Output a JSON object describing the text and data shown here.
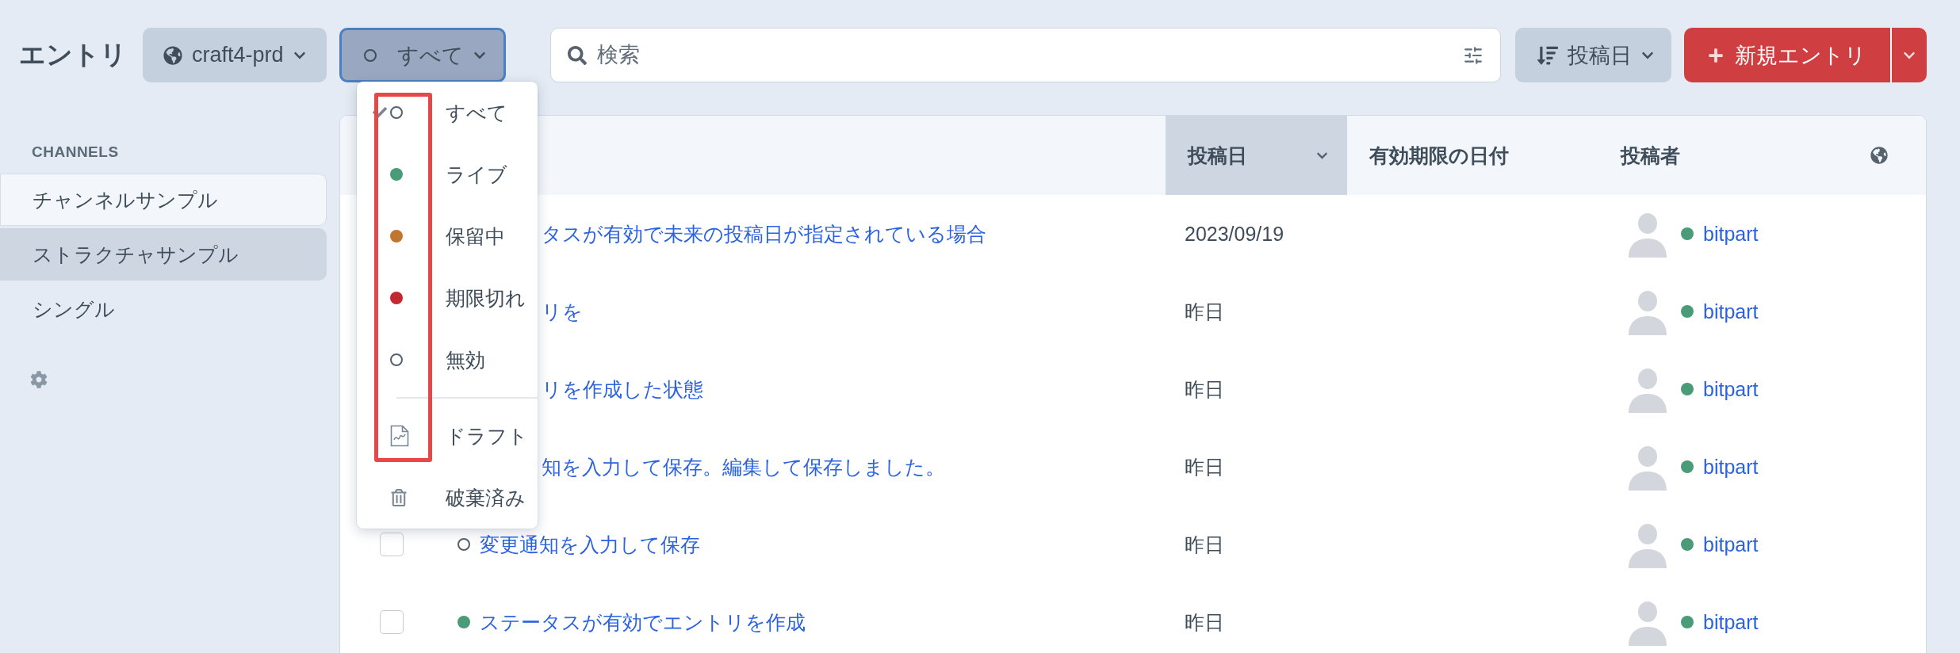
{
  "header": {
    "title": "エントリ",
    "site_button": "craft4-prd",
    "status_button": "すべて",
    "search": {
      "placeholder": "検索"
    },
    "sort_button": "投稿日",
    "new_button": "新規エントリ"
  },
  "sidebar": {
    "heading": "CHANNELS",
    "items": [
      {
        "label": "チャンネルサンプル",
        "selected": false,
        "hovered": true
      },
      {
        "label": "ストラクチャサンプル",
        "selected": true,
        "hovered": false
      },
      {
        "label": "シングル",
        "selected": false,
        "hovered": false
      }
    ]
  },
  "status_menu": {
    "items": [
      {
        "kind": "circle",
        "label": "すべて",
        "selected": true
      },
      {
        "kind": "dot",
        "label": "ライブ",
        "color": "#4a9c78",
        "selected": false
      },
      {
        "kind": "dot",
        "label": "保留中",
        "color": "#c0762e",
        "selected": false
      },
      {
        "kind": "dot",
        "label": "期限切れ",
        "color": "#c1282f",
        "selected": false
      },
      {
        "kind": "circle",
        "label": "無効",
        "selected": false
      },
      {
        "kind": "divider"
      },
      {
        "kind": "draft",
        "label": "ドラフト",
        "selected": false
      },
      {
        "kind": "trash",
        "label": "破棄済み",
        "selected": false
      }
    ]
  },
  "table": {
    "columns": [
      {
        "label": "投稿日",
        "sorted": true
      },
      {
        "label": "有効期限の日付",
        "sorted": false
      },
      {
        "label": "投稿者",
        "sorted": false
      }
    ],
    "rows": [
      {
        "covered": true,
        "title": "タスが有効で未来の投稿日が指定されている場合",
        "date": "2023/09/19",
        "author": "bitpart"
      },
      {
        "covered": true,
        "title": "リを",
        "date": "昨日",
        "author": "bitpart"
      },
      {
        "covered": true,
        "title": "リを作成した状態",
        "date": "昨日",
        "author": "bitpart"
      },
      {
        "covered": true,
        "title": "知を入力して保存。編集して保存しました。",
        "date": "昨日",
        "author": "bitpart"
      },
      {
        "covered": false,
        "checked": false,
        "dot": {
          "kind": "circle"
        },
        "title": "変更通知を入力して保存",
        "date": "昨日",
        "author": "bitpart"
      },
      {
        "covered": false,
        "checked": false,
        "dot": {
          "kind": "dot",
          "color": "#4a9c78"
        },
        "title": "ステータスが有効でエントリを作成",
        "date": "昨日",
        "author": "bitpart"
      }
    ]
  }
}
